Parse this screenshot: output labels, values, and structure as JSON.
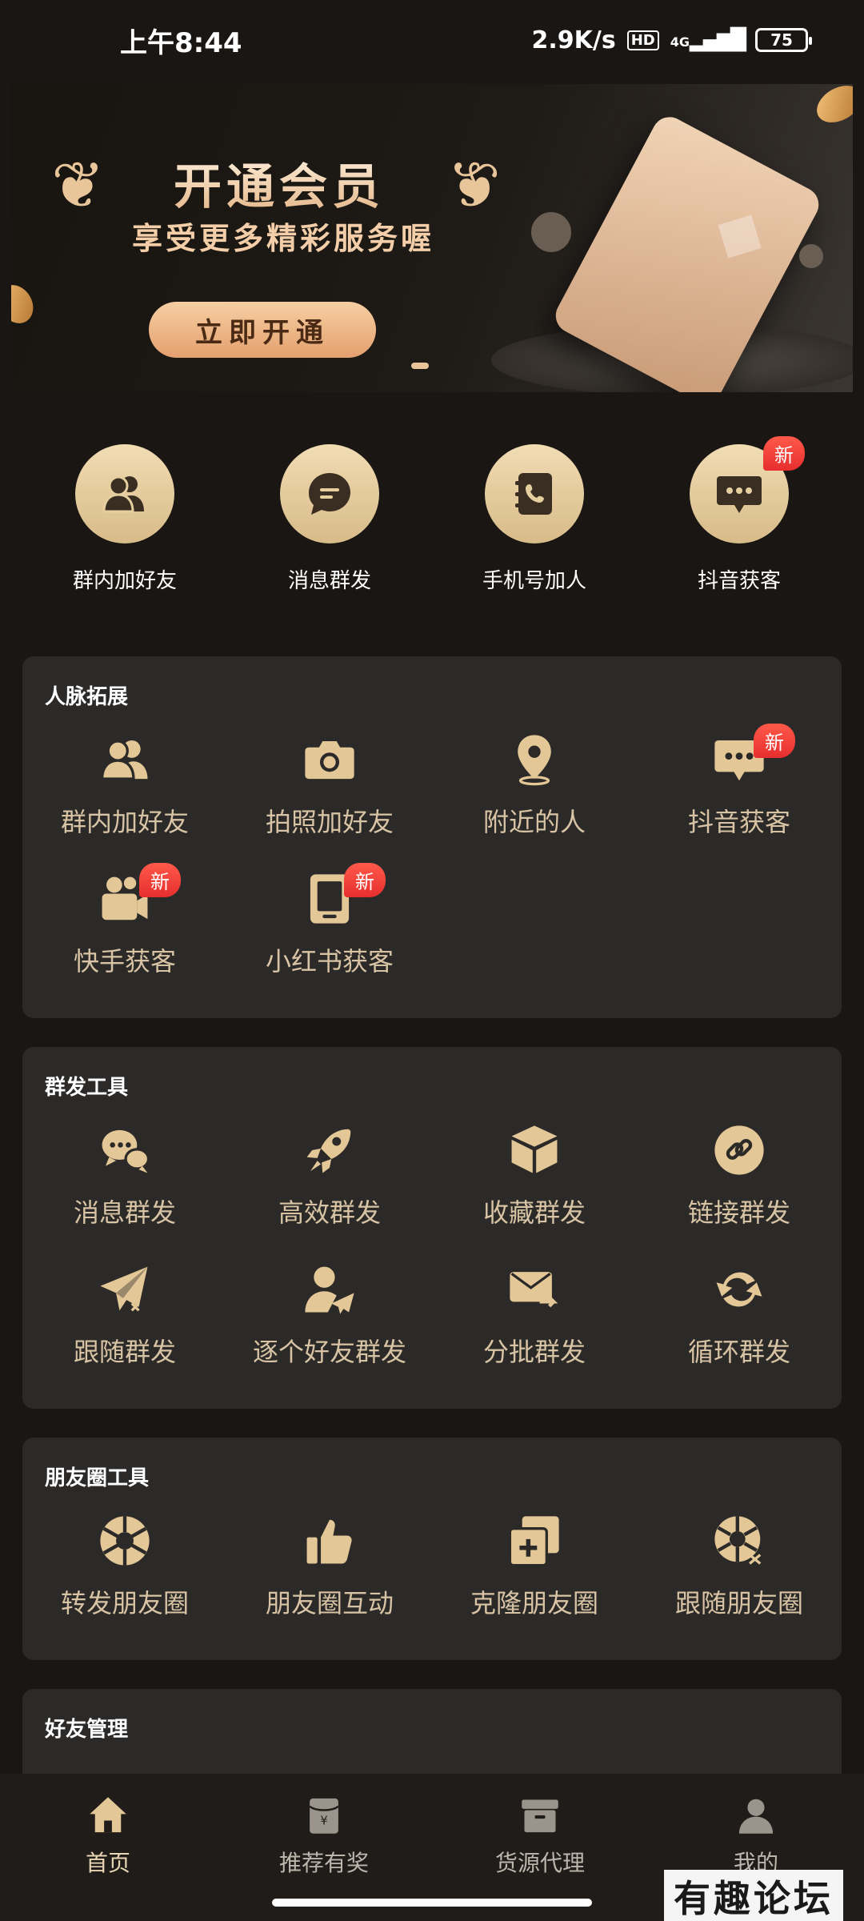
{
  "status_bar": {
    "time": "上午8:44",
    "speed": "2.9K/s",
    "hd": "HD",
    "network": "4G",
    "battery": "75"
  },
  "banner": {
    "title": "开通会员",
    "subtitle": "享受更多精彩服务喔",
    "button": "立即开通"
  },
  "quick_actions": [
    {
      "label": "群内加好友",
      "icon": "users-icon"
    },
    {
      "label": "消息群发",
      "icon": "chat-bubble-icon"
    },
    {
      "label": "手机号加人",
      "icon": "phone-book-icon"
    },
    {
      "label": "抖音获客",
      "icon": "message-dots-icon",
      "badge": "新"
    }
  ],
  "sections": {
    "network": {
      "title": "人脉拓展",
      "items": [
        {
          "label": "群内加好友",
          "icon": "users-icon"
        },
        {
          "label": "拍照加好友",
          "icon": "camera-icon"
        },
        {
          "label": "附近的人",
          "icon": "location-pin-icon"
        },
        {
          "label": "抖音获客",
          "icon": "message-dots-icon",
          "badge": "新"
        },
        {
          "label": "快手获客",
          "icon": "video-camera-icon",
          "badge": "新"
        },
        {
          "label": "小红书获客",
          "icon": "book-icon",
          "badge": "新"
        }
      ]
    },
    "broadcast": {
      "title": "群发工具",
      "items": [
        {
          "label": "消息群发",
          "icon": "chat-bubbles-icon"
        },
        {
          "label": "高效群发",
          "icon": "rocket-icon"
        },
        {
          "label": "收藏群发",
          "icon": "box-icon"
        },
        {
          "label": "链接群发",
          "icon": "link-icon"
        },
        {
          "label": "跟随群发",
          "icon": "paper-plane-shuffle-icon"
        },
        {
          "label": "逐个好友群发",
          "icon": "user-send-icon"
        },
        {
          "label": "分批群发",
          "icon": "mail-forward-icon"
        },
        {
          "label": "循环群发",
          "icon": "refresh-icon"
        }
      ]
    },
    "moments": {
      "title": "朋友圈工具",
      "items": [
        {
          "label": "转发朋友圈",
          "icon": "aperture-icon"
        },
        {
          "label": "朋友圈互动",
          "icon": "thumbs-up-icon"
        },
        {
          "label": "克隆朋友圈",
          "icon": "clone-plus-icon"
        },
        {
          "label": "跟随朋友圈",
          "icon": "aperture-shuffle-icon"
        }
      ]
    },
    "friends": {
      "title": "好友管理"
    }
  },
  "tabs": [
    {
      "label": "首页",
      "icon": "home-icon",
      "active": true
    },
    {
      "label": "推荐有奖",
      "icon": "red-packet-icon"
    },
    {
      "label": "货源代理",
      "icon": "archive-box-icon"
    },
    {
      "label": "我的",
      "icon": "user-icon"
    }
  ],
  "watermark": "有趣论坛",
  "colors": {
    "background": "#1a1613",
    "card": "#2c2a28",
    "gold": "#e8d6b4",
    "icon_gold": "#e3c796",
    "badge_red": "#e62e2e"
  }
}
